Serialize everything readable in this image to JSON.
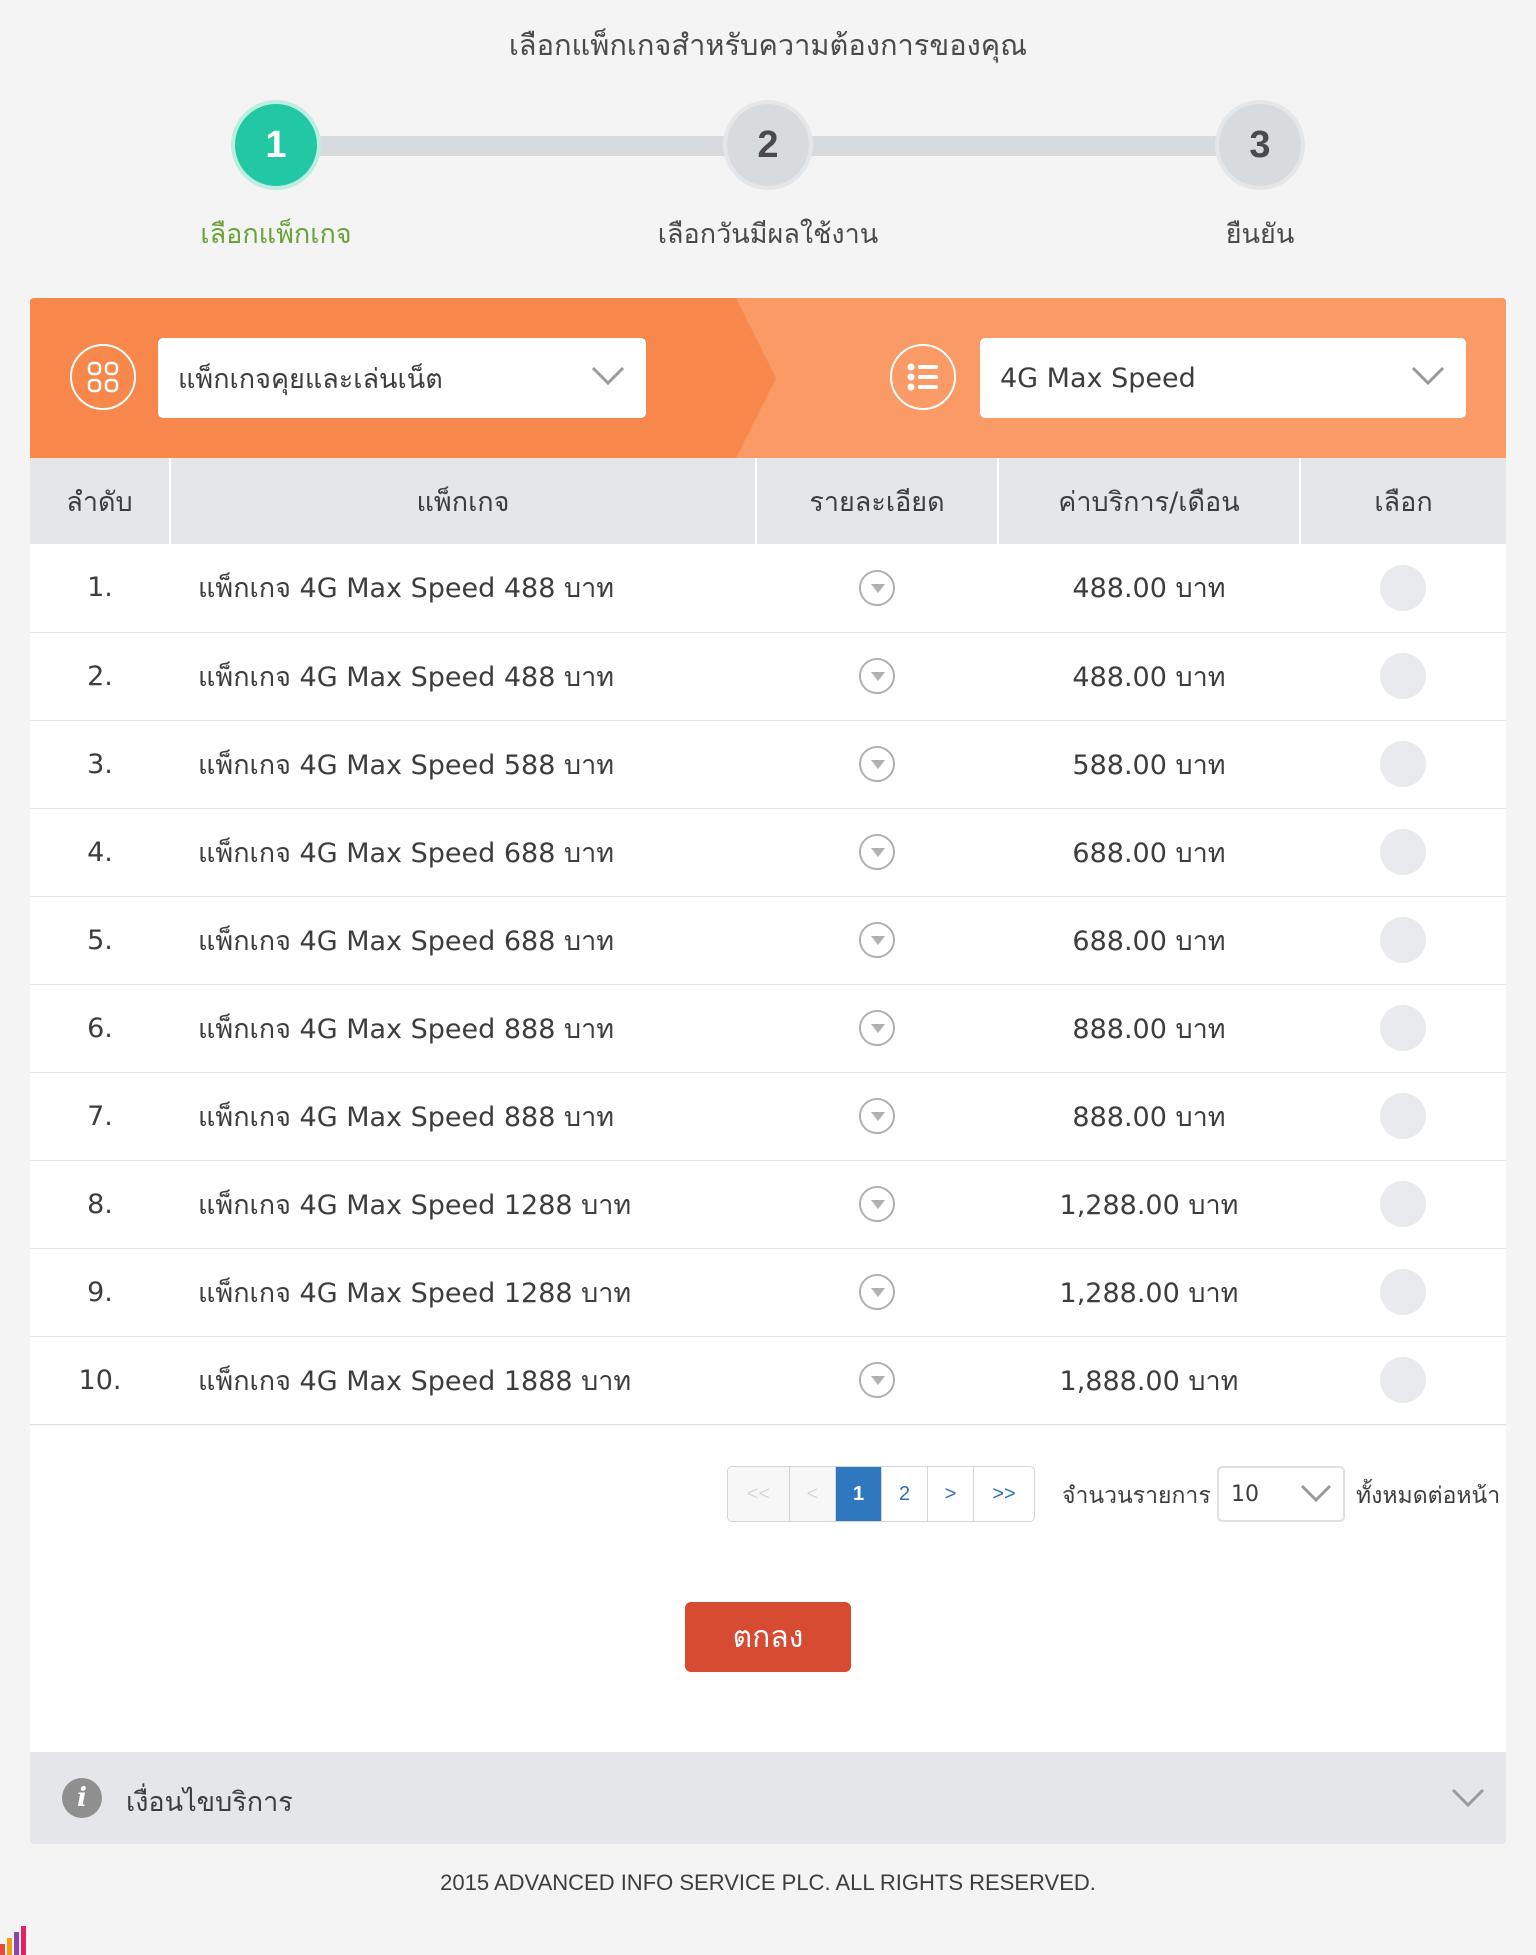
{
  "page": {
    "title": "เลือกแพ็กเกจสำหรับความต้องการของคุณ"
  },
  "stepper": {
    "active_step": 1,
    "steps": [
      {
        "number": "1",
        "label": "เลือกแพ็กเกจ"
      },
      {
        "number": "2",
        "label": "เลือกวันมีผลใช้งาน"
      },
      {
        "number": "3",
        "label": "ยืนยัน"
      }
    ]
  },
  "filters": {
    "category": {
      "icon": "grid-icon",
      "value": "แพ็กเกจคุยและเล่นเน็ต"
    },
    "subcategory": {
      "icon": "list-icon",
      "value": "4G Max Speed"
    }
  },
  "table": {
    "headers": {
      "no": "ลำดับ",
      "package": "แพ็กเกจ",
      "detail": "รายละเอียด",
      "price": "ค่าบริการ/เดือน",
      "select": "เลือก"
    },
    "rows": [
      {
        "no": "1.",
        "name": "แพ็กเกจ 4G Max Speed 488 บาท",
        "price": "488.00 บาท"
      },
      {
        "no": "2.",
        "name": "แพ็กเกจ 4G Max Speed 488 บาท",
        "price": "488.00 บาท"
      },
      {
        "no": "3.",
        "name": "แพ็กเกจ 4G Max Speed 588 บาท",
        "price": "588.00 บาท"
      },
      {
        "no": "4.",
        "name": "แพ็กเกจ 4G Max Speed 688 บาท",
        "price": "688.00 บาท"
      },
      {
        "no": "5.",
        "name": "แพ็กเกจ 4G Max Speed 688 บาท",
        "price": "688.00 บาท"
      },
      {
        "no": "6.",
        "name": "แพ็กเกจ 4G Max Speed 888 บาท",
        "price": "888.00 บาท"
      },
      {
        "no": "7.",
        "name": "แพ็กเกจ 4G Max Speed 888 บาท",
        "price": "888.00 บาท"
      },
      {
        "no": "8.",
        "name": "แพ็กเกจ 4G Max Speed 1288 บาท",
        "price": "1,288.00 บาท"
      },
      {
        "no": "9.",
        "name": "แพ็กเกจ 4G Max Speed 1288 บาท",
        "price": "1,288.00 บาท"
      },
      {
        "no": "10.",
        "name": "แพ็กเกจ 4G Max Speed 1888 บาท",
        "price": "1,888.00 บาท"
      }
    ]
  },
  "pagination": {
    "first": "<<",
    "prev": "<",
    "pages": [
      "1",
      "2"
    ],
    "current_page": "1",
    "next": ">",
    "last": ">>",
    "per_page_label": "จำนวนรายการ",
    "per_page_value": "10",
    "per_page_suffix": "ทั้งหมดต่อหน้า"
  },
  "actions": {
    "ok_label": "ตกลง"
  },
  "conditions": {
    "icon_glyph": "i",
    "label": "เงื่อนไขบริการ"
  },
  "footer": {
    "copyright": "2015 ADVANCED INFO SERVICE PLC. ALL RIGHTS RESERVED."
  },
  "colors": {
    "accent_orange": "#f7874a",
    "accent_orange_light": "#fa9a66",
    "step_active": "#22c8a4",
    "step_label_active": "#6aa33a",
    "ok_button": "#d64b31",
    "pager_active": "#2f78bf"
  }
}
